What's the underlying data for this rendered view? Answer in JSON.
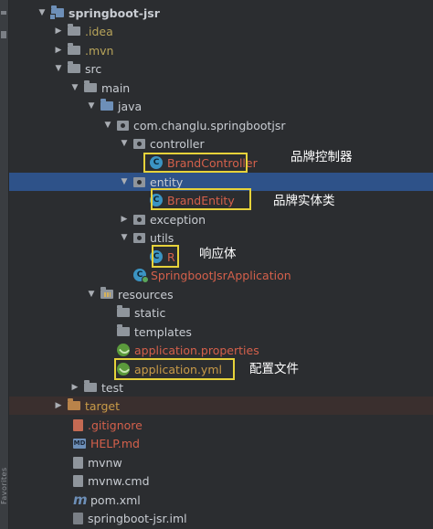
{
  "side_strip": {
    "label": "Favorites"
  },
  "tree": [
    {
      "label": "springboot-jsr",
      "arrow": "open",
      "icon": "folder-module-icon",
      "color": "#c8ccd2",
      "bold": true
    },
    {
      "label": ".idea",
      "arrow": "closed",
      "icon": "folder-icon"
    },
    {
      "label": ".mvn",
      "arrow": "closed",
      "icon": "folder-icon"
    },
    {
      "label": "src",
      "arrow": "open",
      "icon": "folder-icon"
    },
    {
      "label": "main",
      "arrow": "open",
      "icon": "folder-icon"
    },
    {
      "label": "java",
      "arrow": "open",
      "icon": "folder-source-icon"
    },
    {
      "label": "com.changlu.springbootjsr",
      "arrow": "open",
      "icon": "package-icon"
    },
    {
      "label": "controller",
      "arrow": "open",
      "icon": "package-icon"
    },
    {
      "label": "BrandController",
      "arrow": "none",
      "icon": "class-icon"
    },
    {
      "label": "entity",
      "arrow": "open",
      "icon": "package-icon",
      "selected": true
    },
    {
      "label": "BrandEntity",
      "arrow": "none",
      "icon": "class-icon"
    },
    {
      "label": "exception",
      "arrow": "closed",
      "icon": "package-icon"
    },
    {
      "label": "utils",
      "arrow": "open",
      "icon": "package-icon"
    },
    {
      "label": "R",
      "arrow": "none",
      "icon": "class-icon"
    },
    {
      "label": "SpringbootJsrApplication",
      "arrow": "none",
      "icon": "spring-app-class-icon"
    },
    {
      "label": "resources",
      "arrow": "open",
      "icon": "folder-resources-icon"
    },
    {
      "label": "static",
      "arrow": "none",
      "icon": "folder-icon"
    },
    {
      "label": "templates",
      "arrow": "none",
      "icon": "folder-icon"
    },
    {
      "label": "application.properties",
      "arrow": "none",
      "icon": "spring-config-icon"
    },
    {
      "label": "application.yml",
      "arrow": "none",
      "icon": "spring-config-icon"
    },
    {
      "label": "test",
      "arrow": "closed",
      "icon": "folder-icon"
    },
    {
      "label": "target",
      "arrow": "closed",
      "icon": "folder-excluded-icon",
      "excluded": true
    },
    {
      "label": ".gitignore",
      "arrow": "none",
      "icon": "gitignore-file-icon"
    },
    {
      "label": "HELP.md",
      "arrow": "none",
      "icon": "markdown-file-icon"
    },
    {
      "label": "mvnw",
      "arrow": "none",
      "icon": "file-icon"
    },
    {
      "label": "mvnw.cmd",
      "arrow": "none",
      "icon": "file-icon"
    },
    {
      "label": "pom.xml",
      "arrow": "none",
      "icon": "maven-icon"
    },
    {
      "label": "springboot-jsr.iml",
      "arrow": "none",
      "icon": "iml-file-icon"
    }
  ],
  "annotations": {
    "controller_note": "品牌控制器",
    "entity_note": "品牌实体类",
    "response_note": "响应体",
    "config_note": "配置文件"
  },
  "colors": {
    "background": "#2b2d30",
    "selection": "#2e5289",
    "highlight_box": "#e6d23a",
    "class_label": "#d4604b",
    "package_label": "#c8ccd2",
    "yml_label": "#c99b48"
  }
}
